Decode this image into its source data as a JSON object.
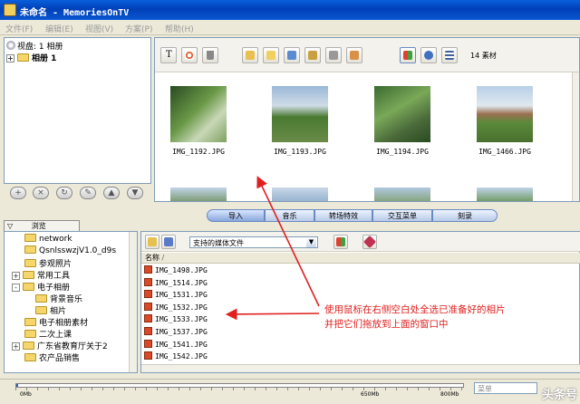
{
  "window": {
    "title": "未命名 - MemoriesOnTV"
  },
  "menu": [
    {
      "label": "文件(F)"
    },
    {
      "label": "编辑(E)"
    },
    {
      "label": "视图(V)"
    },
    {
      "label": "方案(P)"
    },
    {
      "label": "帮助(H)"
    }
  ],
  "disc_tree": {
    "root": "视盘: 1 相册",
    "album": "相册 1"
  },
  "media_toolbar": {
    "count_label": "14 素材"
  },
  "thumbnails": [
    {
      "label": "IMG_1192.JPG"
    },
    {
      "label": "IMG_1193.JPG"
    },
    {
      "label": "IMG_1194.JPG"
    },
    {
      "label": "IMG_1466.JPG"
    }
  ],
  "main_tabs": [
    {
      "label": "导入"
    },
    {
      "label": "音乐"
    },
    {
      "label": "转场特效"
    },
    {
      "label": "交互菜单"
    },
    {
      "label": "刻录"
    }
  ],
  "browser_tab": {
    "label": "浏览"
  },
  "folder_tree": [
    {
      "label": "network",
      "indent": 0
    },
    {
      "label": "QsnlsswzjV1.0_d9s",
      "indent": 0
    },
    {
      "label": "参观照片",
      "indent": 0
    },
    {
      "label": "常用工具",
      "indent": 0,
      "expander": "+"
    },
    {
      "label": "电子相册",
      "indent": 0,
      "expander": "-"
    },
    {
      "label": "背景音乐",
      "indent": 1
    },
    {
      "label": "相片",
      "indent": 1
    },
    {
      "label": "电子相册素材",
      "indent": 0
    },
    {
      "label": "二次上课",
      "indent": 0
    },
    {
      "label": "广东省教育厅关于2",
      "indent": 0,
      "expander": "+"
    },
    {
      "label": "农产品销售",
      "indent": 0
    }
  ],
  "file_panel": {
    "filter_value": "支持的媒体文件",
    "column_header": "名称",
    "files": [
      {
        "name": "IMG_1498.JPG"
      },
      {
        "name": "IMG_1514.JPG"
      },
      {
        "name": "IMG_1531.JPG"
      },
      {
        "name": "IMG_1532.JPG"
      },
      {
        "name": "IMG_1533.JPG"
      },
      {
        "name": "IMG_1537.JPG"
      },
      {
        "name": "IMG_1541.JPG"
      },
      {
        "name": "IMG_1542.JPG"
      }
    ]
  },
  "annotation": {
    "line1": "使用鼠标在右侧空白处全选已准备好的相片",
    "line2": "并把它们拖放到上面的窗口中"
  },
  "capacity": {
    "start": "0Mb",
    "mark1": "650Mb",
    "mark2": "800Mb",
    "mode_value": "菜单"
  },
  "watermark": "头条号",
  "colors": {
    "annotation": "#e02020",
    "titlebar": "#0a5fdc"
  }
}
